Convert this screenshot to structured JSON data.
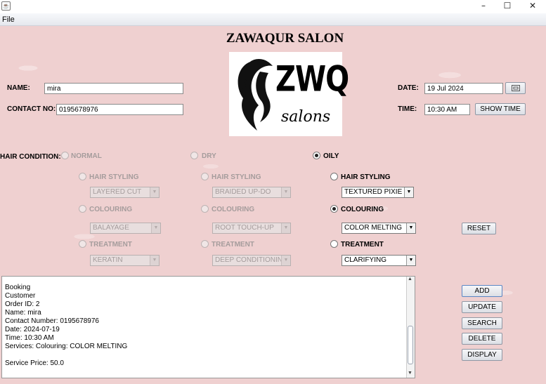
{
  "window": {
    "icon": "java-icon",
    "minimize": "–",
    "maximize": "☐",
    "close": "✕"
  },
  "menu": {
    "file": "File"
  },
  "title": "ZAWAQUR SALON",
  "logo": {
    "letters": "ZWQ",
    "script": "salons"
  },
  "name": {
    "label": "NAME:",
    "value": "mira"
  },
  "contact": {
    "label": "CONTACT NO:",
    "value": "0195678976"
  },
  "date": {
    "label": "DATE:",
    "value": "19 Jul 2024"
  },
  "time": {
    "label": "TIME:",
    "value": "10:30 AM",
    "button": "SHOW TIME"
  },
  "hair_condition": {
    "label": "HAIR CONDITION:",
    "options": [
      "NORMAL",
      "DRY",
      "OILY"
    ],
    "selected": "OILY"
  },
  "columns": [
    {
      "styling": "HAIR STYLING",
      "styling_value": "LAYERED CUT",
      "colouring": "COLOURING",
      "colouring_value": "BALAYAGE",
      "treatment": "TREATMENT",
      "treatment_value": "KERATIN"
    },
    {
      "styling": "HAIR STYLING",
      "styling_value": "BRAIDED UP-DO",
      "colouring": "COLOURING",
      "colouring_value": "ROOT TOUCH-UP",
      "treatment": "TREATMENT",
      "treatment_value": "DEEP CONDITIONING"
    },
    {
      "styling": "HAIR STYLING",
      "styling_value": "TEXTURED PIXIE ...",
      "colouring": "COLOURING",
      "colouring_value": "COLOR MELTING",
      "treatment": "TREATMENT",
      "treatment_value": "CLARIFYING"
    }
  ],
  "selected_service": "COLOURING",
  "buttons": {
    "reset": "RESET",
    "add": "ADD",
    "update": "UPDATE",
    "search": "SEARCH",
    "delete": "DELETE",
    "display": "DISPLAY"
  },
  "output_lines": [
    "Booking",
    "Customer",
    "Order ID: 2",
    "Name: mira",
    "Contact Number: 0195678976",
    "Date: 2024-07-19",
    "Time: 10:30 AM",
    "Services: Colouring: COLOR MELTING",
    "",
    "Service Price: 50.0"
  ],
  "colors": {
    "background": "#efd0d0",
    "title_text": "#000000"
  }
}
